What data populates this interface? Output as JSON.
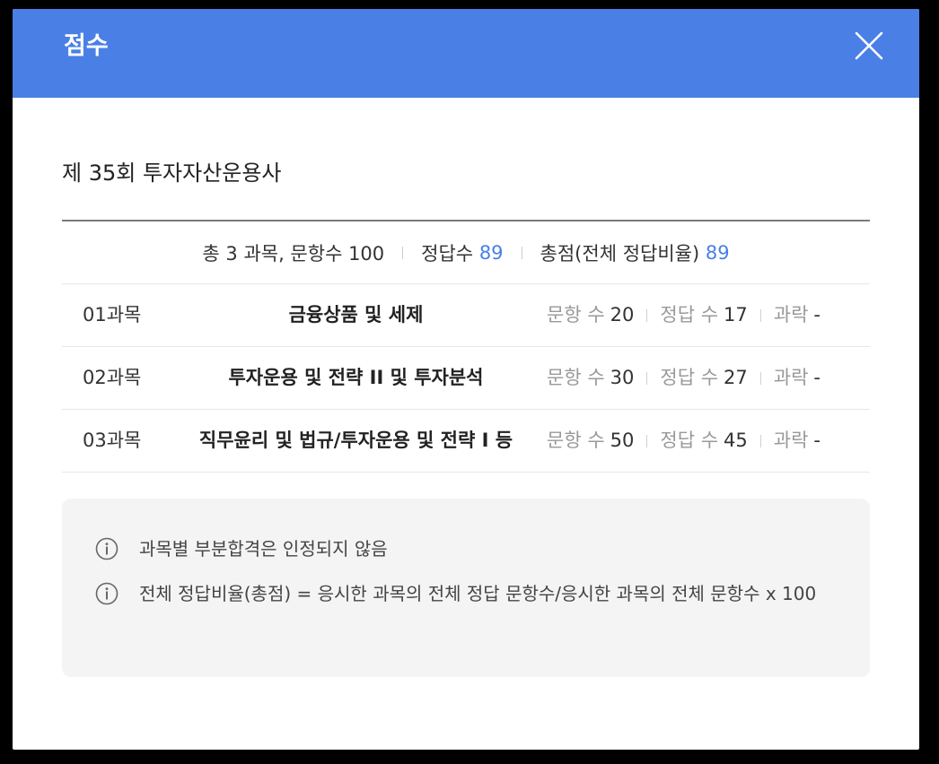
{
  "modal": {
    "title": "점수",
    "close_icon": "close-icon"
  },
  "exam": {
    "title": "제 35회 투자자산운용사"
  },
  "summary": {
    "subjects_text": "총 3 과목, 문항수 100",
    "correct_label": "정답수",
    "correct_value": "89",
    "total_label": "총점(전체 정답비율)",
    "total_value": "89"
  },
  "subjects": [
    {
      "num": "01과목",
      "name": "금융상품 및 세제",
      "questions_label": "문항 수",
      "questions": "20",
      "correct_label": "정답 수",
      "correct": "17",
      "fail_label": "과락",
      "fail": "-"
    },
    {
      "num": "02과목",
      "name": "투자운용 및 전략 II 및 투자분석",
      "questions_label": "문항 수",
      "questions": "30",
      "correct_label": "정답 수",
      "correct": "27",
      "fail_label": "과락",
      "fail": "-"
    },
    {
      "num": "03과목",
      "name": "직무윤리 및 법규/투자운용 및 전략 I 등",
      "questions_label": "문항 수",
      "questions": "50",
      "correct_label": "정답 수",
      "correct": "45",
      "fail_label": "과락",
      "fail": "-"
    }
  ],
  "notes": [
    {
      "icon": "info-icon",
      "text": "과목별 부분합격은 인정되지 않음"
    },
    {
      "icon": "info-icon",
      "text": "전체 정답비율(총점) = 응시한 과목의 전체 정답 문항수/응시한 과목의 전체 문항수 x 100"
    }
  ],
  "colors": {
    "header": "#4a7fe6",
    "accent": "#4a7fe6"
  }
}
